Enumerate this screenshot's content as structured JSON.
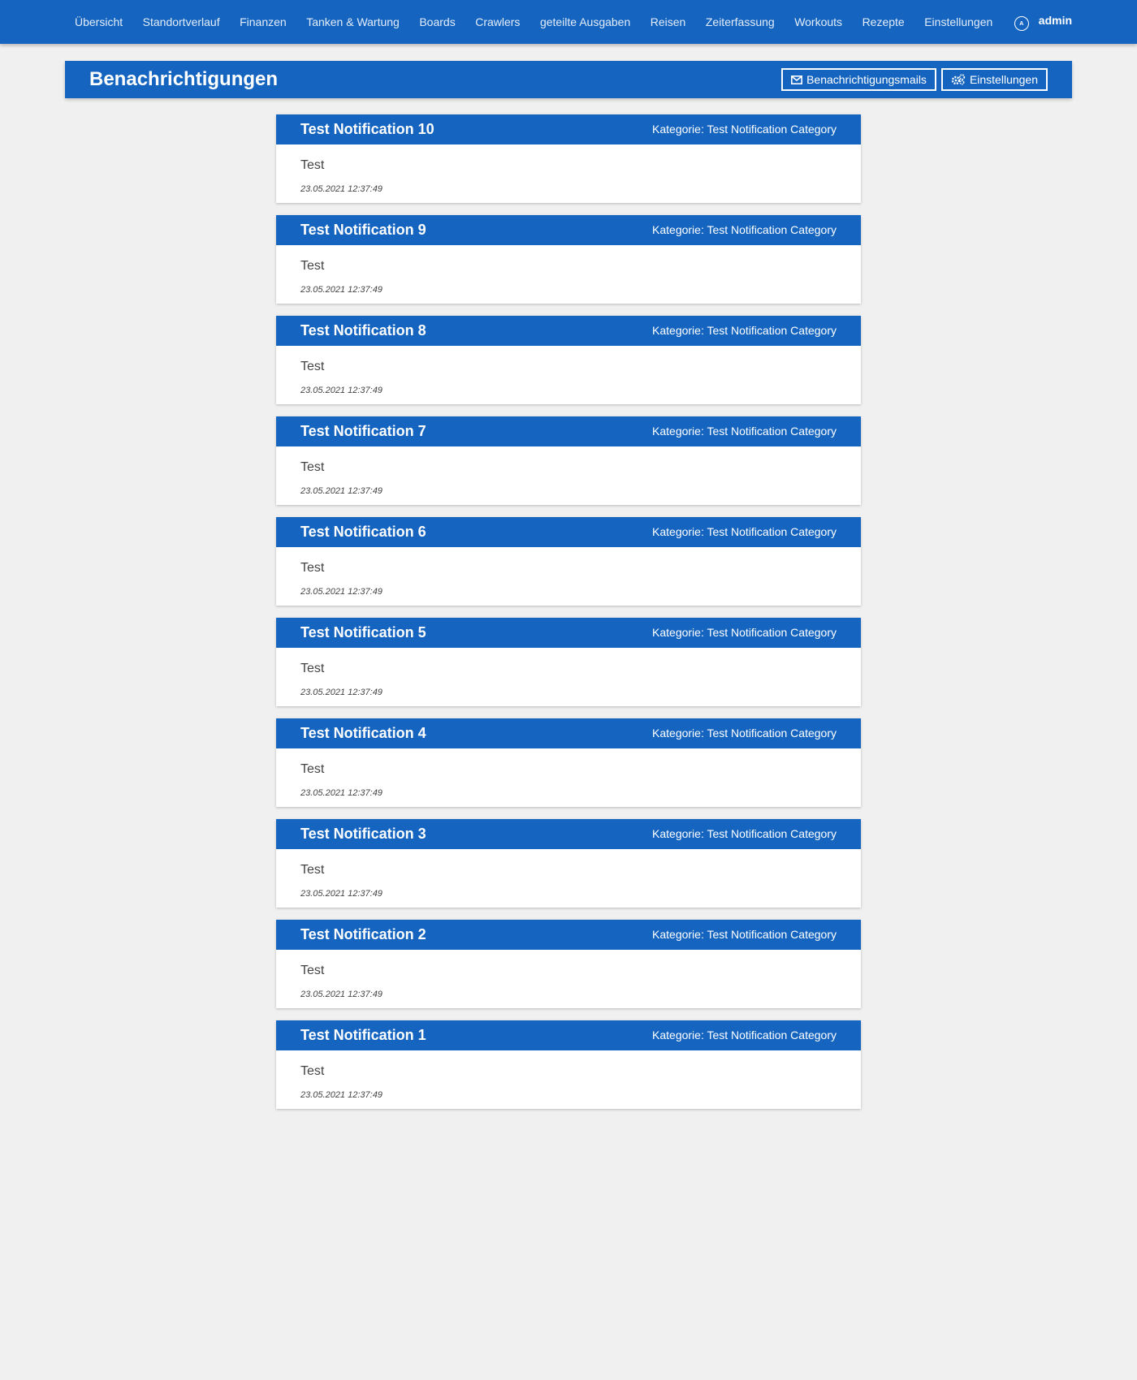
{
  "nav": {
    "items": [
      {
        "label": "Übersicht"
      },
      {
        "label": "Standortverlauf"
      },
      {
        "label": "Finanzen"
      },
      {
        "label": "Tanken & Wartung"
      },
      {
        "label": "Boards"
      },
      {
        "label": "Crawlers"
      },
      {
        "label": "geteilte Ausgaben"
      },
      {
        "label": "Reisen"
      },
      {
        "label": "Zeiterfassung"
      },
      {
        "label": "Workouts"
      },
      {
        "label": "Rezepte"
      },
      {
        "label": "Einstellungen"
      }
    ],
    "user": {
      "icon": "user-circle-icon",
      "initial": "A",
      "name": "admin"
    }
  },
  "header": {
    "title": "Benachrichtigungen",
    "mails_label": "Benachrichtigungsmails",
    "settings_label": "Einstellungen",
    "mails_icon": "envelope-icon",
    "settings_icon": "gears-icon"
  },
  "notifications": [
    {
      "title": "Test Notification 10",
      "category": "Kategorie: Test Notification Category",
      "message": "Test",
      "date": "23.05.2021 12:37:49"
    },
    {
      "title": "Test Notification 9",
      "category": "Kategorie: Test Notification Category",
      "message": "Test",
      "date": "23.05.2021 12:37:49"
    },
    {
      "title": "Test Notification 8",
      "category": "Kategorie: Test Notification Category",
      "message": "Test",
      "date": "23.05.2021 12:37:49"
    },
    {
      "title": "Test Notification 7",
      "category": "Kategorie: Test Notification Category",
      "message": "Test",
      "date": "23.05.2021 12:37:49"
    },
    {
      "title": "Test Notification 6",
      "category": "Kategorie: Test Notification Category",
      "message": "Test",
      "date": "23.05.2021 12:37:49"
    },
    {
      "title": "Test Notification 5",
      "category": "Kategorie: Test Notification Category",
      "message": "Test",
      "date": "23.05.2021 12:37:49"
    },
    {
      "title": "Test Notification 4",
      "category": "Kategorie: Test Notification Category",
      "message": "Test",
      "date": "23.05.2021 12:37:49"
    },
    {
      "title": "Test Notification 3",
      "category": "Kategorie: Test Notification Category",
      "message": "Test",
      "date": "23.05.2021 12:37:49"
    },
    {
      "title": "Test Notification 2",
      "category": "Kategorie: Test Notification Category",
      "message": "Test",
      "date": "23.05.2021 12:37:49"
    },
    {
      "title": "Test Notification 1",
      "category": "Kategorie: Test Notification Category",
      "message": "Test",
      "date": "23.05.2021 12:37:49"
    }
  ],
  "colors": {
    "primary": "#1565c0",
    "background": "#f0f0f0"
  }
}
